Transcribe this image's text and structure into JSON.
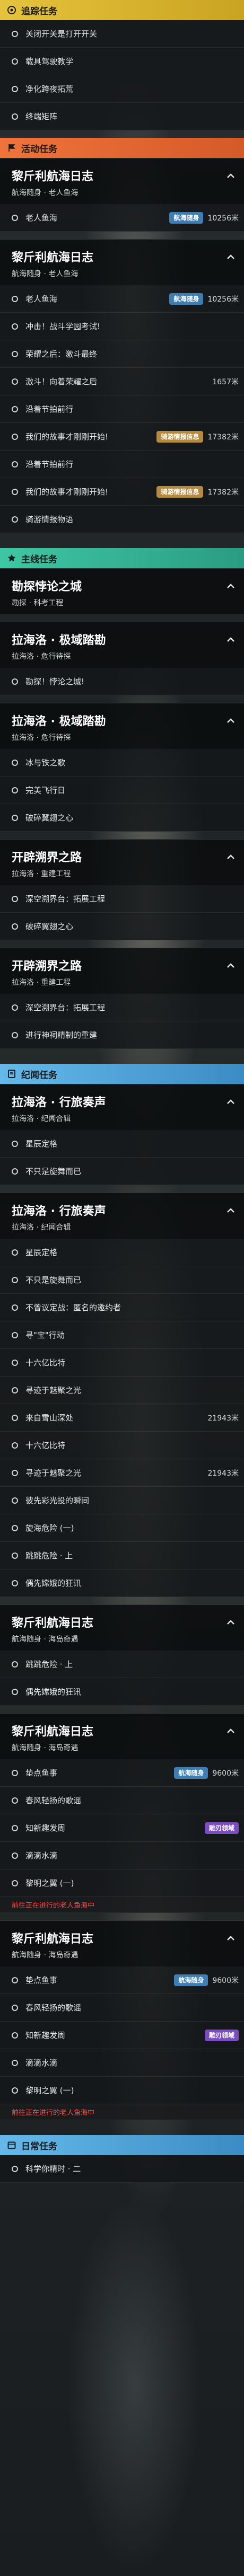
{
  "sections": {
    "tracking": "追踪任务",
    "events": "活动任务",
    "main": "主线任务",
    "legend": "纪闻任务",
    "daily": "日常任务"
  },
  "tracking_items": [
    "关闭开关是打开开关",
    "载具驾驶教学",
    "净化跨夜拓荒",
    "终端矩阵"
  ],
  "event_groups": [
    {
      "title": "黎斤利航海日志",
      "subtitle": "航海随身 · 老人鱼海",
      "rows": [
        {
          "label": "老人鱼海",
          "distance": "10256米",
          "tag": "航海随身"
        }
      ]
    },
    {
      "title": "黎斤利航海日志",
      "subtitle": "航海随身 · 老人鱼海",
      "rows": [
        {
          "label": "老人鱼海",
          "distance": "10256米",
          "tag": "航海随身"
        },
        {
          "label": "冲击！战斗学园考试!",
          "distance": ""
        },
        {
          "label": "荣耀之后：激斗最终",
          "distance": ""
        },
        {
          "label": "激斗！向着荣耀之后",
          "distance": "1657米"
        },
        {
          "label": "沿着节拍前行",
          "distance": ""
        },
        {
          "label": "我们的故事才刚刚开始!",
          "distance": "17382米",
          "tag": "骑游情报信息"
        },
        {
          "label": "沿着节拍前行",
          "distance": ""
        },
        {
          "label": "我们的故事才刚刚开始!",
          "distance": "17382米",
          "tag": "骑游情报信息"
        },
        {
          "label": "骑游情报物语",
          "distance": ""
        }
      ]
    }
  ],
  "main_groups": [
    {
      "title": "勘探悖论之城",
      "subtitle": "勘探 · 科考工程",
      "rows": []
    },
    {
      "title": "拉海洛 · 极域踏勘",
      "subtitle": "拉海洛 · 危行待探",
      "rows": [
        {
          "label": "勘探！悖论之城!",
          "distance": ""
        }
      ]
    },
    {
      "title": "拉海洛 · 极域踏勘",
      "subtitle": "拉海洛 · 危行待探",
      "rows": [
        {
          "label": "冰与铁之歌",
          "distance": ""
        },
        {
          "label": "完美飞行日",
          "distance": ""
        },
        {
          "label": "破碎翼翅之心",
          "distance": ""
        }
      ]
    },
    {
      "title": "开辟溯界之路",
      "subtitle": "拉海洛 · 重建工程",
      "rows": [
        {
          "label": "深空溯界台：拓展工程",
          "distance": ""
        },
        {
          "label": "破碎翼翅之心",
          "distance": ""
        }
      ]
    },
    {
      "title": "开辟溯界之路",
      "subtitle": "拉海洛 · 重建工程",
      "rows": [
        {
          "label": "深空溯界台：拓展工程",
          "distance": ""
        },
        {
          "label": "进行神祠精制的重建",
          "distance": ""
        }
      ]
    }
  ],
  "legend_groups": [
    {
      "title": "拉海洛 · 行旅奏声",
      "subtitle": "拉海洛 · 纪闻合辑",
      "rows": [
        {
          "label": "星辰定格",
          "distance": ""
        },
        {
          "label": "不只是旋舞而已",
          "distance": ""
        }
      ]
    },
    {
      "title": "拉海洛 · 行旅奏声",
      "subtitle": "拉海洛 · 纪闻合辑",
      "rows": [
        {
          "label": "星辰定格",
          "distance": ""
        },
        {
          "label": "不只是旋舞而已",
          "distance": ""
        },
        {
          "label": "不曾议定战：匿名的邀约者",
          "distance": ""
        },
        {
          "label": "寻\"宝\"行动",
          "distance": ""
        },
        {
          "label": "十六亿比特",
          "distance": ""
        },
        {
          "label": "寻迹于魅聚之光",
          "distance": ""
        },
        {
          "label": "来自雪山深处",
          "distance": "21943米"
        },
        {
          "label": "十六亿比特",
          "distance": ""
        },
        {
          "label": "寻迹于魅聚之光",
          "distance": "21943米"
        },
        {
          "label": "彼先彩光投的瞬间",
          "distance": ""
        },
        {
          "label": "旋海危险 (一)",
          "distance": ""
        },
        {
          "label": "跳跳危险 · 上",
          "distance": ""
        },
        {
          "label": "偶先嫦娥的狂讯",
          "distance": ""
        }
      ]
    }
  ],
  "legend_groups2": [
    {
      "title": "黎斤利航海日志",
      "subtitle": "航海随身 · 海岛奇遇",
      "rows": [
        {
          "label": "跳跳危险 · 上",
          "distance": ""
        },
        {
          "label": "偶先嫦娥的狂讯",
          "distance": ""
        }
      ]
    },
    {
      "title": "黎斤利航海日志",
      "subtitle": "航海随身 · 海岛奇遇",
      "rows": [
        {
          "label": "垫点鱼事",
          "distance": "9600米",
          "tag": "航海随身"
        },
        {
          "label": "春风轻扬的歌谣",
          "distance": ""
        },
        {
          "label": "知新趣发周",
          "distance": "",
          "tag": "雕刃领域"
        },
        {
          "label": "滴滴水滴",
          "distance": ""
        },
        {
          "label": "黎明之翼 (一)",
          "distance": "",
          "warn": "前往正在进行的老人鱼海中"
        }
      ]
    },
    {
      "title": "黎斤利航海日志",
      "subtitle": "航海随身 · 海岛奇遇",
      "rows": [
        {
          "label": "垫点鱼事",
          "distance": "9600米",
          "tag": "航海随身"
        },
        {
          "label": "春风轻扬的歌谣",
          "distance": ""
        },
        {
          "label": "知新趣发周",
          "distance": "",
          "tag": "雕刃领域"
        },
        {
          "label": "滴滴水滴",
          "distance": ""
        },
        {
          "label": "黎明之翼 (一)",
          "distance": "",
          "warn": "前往正在进行的老人鱼海中"
        }
      ]
    }
  ],
  "daily_items": [
    "科学你精时 · 二"
  ],
  "colors": {
    "green": "#3ec7a4",
    "orange": "#f0733b",
    "blue": "#64b9ea",
    "yellow": "#e6c33c"
  }
}
